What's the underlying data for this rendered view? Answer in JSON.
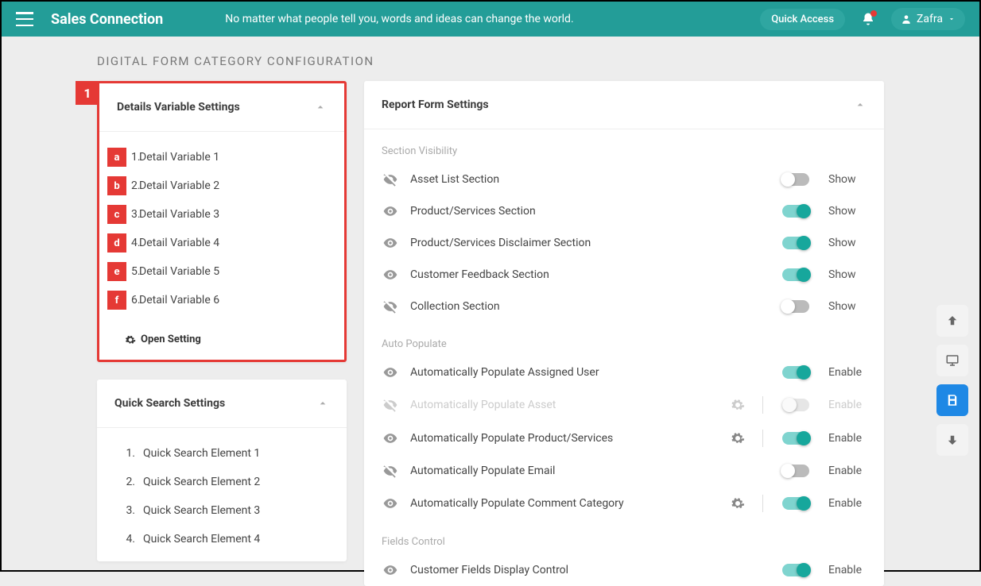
{
  "header": {
    "brand": "Sales Connection",
    "tagline": "No matter what people tell you, words and ideas can change the world.",
    "quick_access": "Quick Access",
    "user": "Zafra"
  },
  "page_title": "DIGITAL FORM CATEGORY CONFIGURATION",
  "details_card": {
    "title": "Details Variable Settings",
    "annotation_main": "1",
    "items": [
      {
        "letter": "a",
        "num": "1.",
        "label": "Detail Variable 1"
      },
      {
        "letter": "b",
        "num": "2.",
        "label": "Detail Variable 2"
      },
      {
        "letter": "c",
        "num": "3.",
        "label": "Detail Variable 3"
      },
      {
        "letter": "d",
        "num": "4.",
        "label": "Detail Variable 4"
      },
      {
        "letter": "e",
        "num": "5.",
        "label": "Detail Variable 5"
      },
      {
        "letter": "f",
        "num": "6.",
        "label": "Detail Variable 6"
      }
    ],
    "open_setting": "Open Setting"
  },
  "quick_search_card": {
    "title": "Quick Search Settings",
    "items": [
      {
        "num": "1.",
        "label": "Quick Search Element 1"
      },
      {
        "num": "2.",
        "label": "Quick Search Element 2"
      },
      {
        "num": "3.",
        "label": "Quick Search Element 3"
      },
      {
        "num": "4.",
        "label": "Quick Search Element 4"
      }
    ]
  },
  "report_card": {
    "title": "Report Form Settings",
    "section_visibility_title": "Section Visibility",
    "auto_populate_title": "Auto Populate",
    "fields_control_title": "Fields Control",
    "visibility_rows": [
      {
        "label": "Asset List Section",
        "visible": false,
        "on": false,
        "status": "Show"
      },
      {
        "label": "Product/Services Section",
        "visible": true,
        "on": true,
        "status": "Show"
      },
      {
        "label": "Product/Services Disclaimer Section",
        "visible": true,
        "on": true,
        "status": "Show"
      },
      {
        "label": "Customer Feedback Section",
        "visible": true,
        "on": true,
        "status": "Show"
      },
      {
        "label": "Collection Section",
        "visible": false,
        "on": false,
        "status": "Show"
      }
    ],
    "auto_populate_rows": [
      {
        "label": "Automatically Populate Assigned User",
        "visible": true,
        "on": true,
        "status": "Enable",
        "gear": false,
        "disabled": false
      },
      {
        "label": "Automatically Populate Asset",
        "visible": false,
        "on": false,
        "status": "Enable",
        "gear": true,
        "disabled": true
      },
      {
        "label": "Automatically Populate Product/Services",
        "visible": true,
        "on": true,
        "status": "Enable",
        "gear": true,
        "disabled": false
      },
      {
        "label": "Automatically Populate Email",
        "visible": false,
        "on": false,
        "status": "Enable",
        "gear": false,
        "disabled": false
      },
      {
        "label": "Automatically Populate Comment Category",
        "visible": true,
        "on": true,
        "status": "Enable",
        "gear": true,
        "disabled": false
      }
    ],
    "fields_control_rows": [
      {
        "label": "Customer Fields Display Control",
        "visible": true,
        "on": true,
        "status": "Enable"
      }
    ]
  }
}
